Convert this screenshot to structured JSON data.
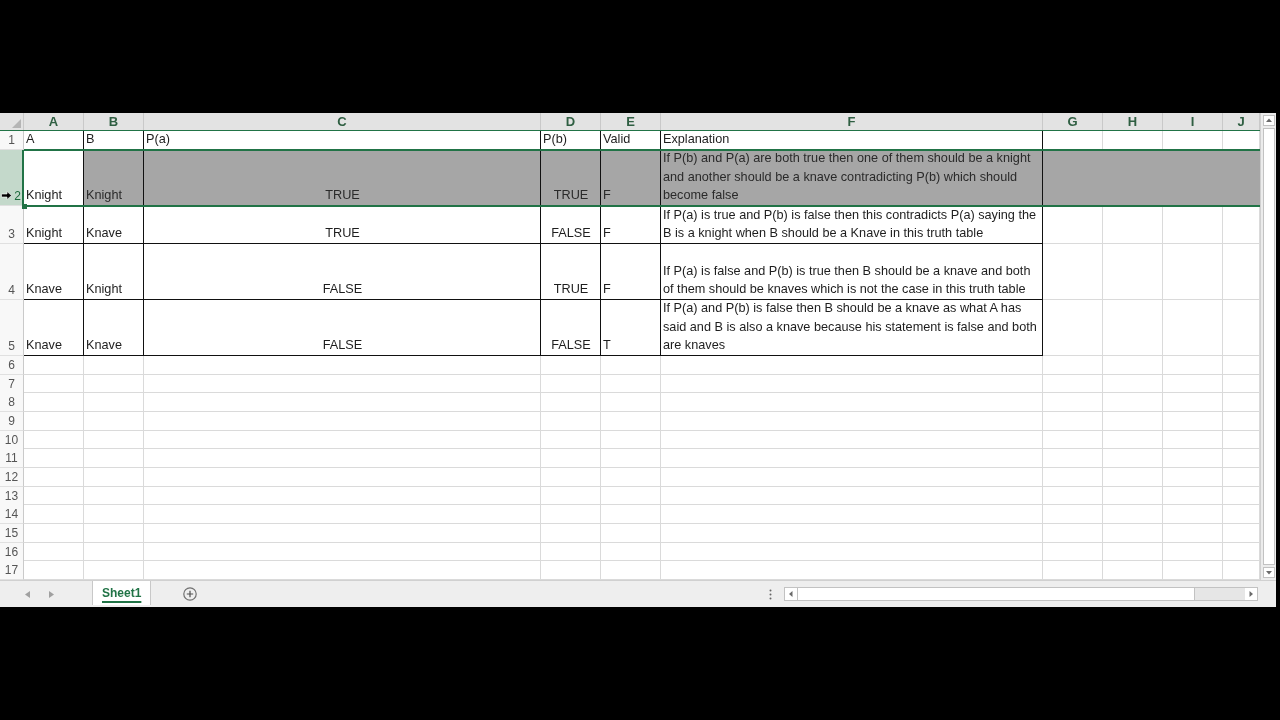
{
  "spreadsheet": {
    "columns": [
      "A",
      "B",
      "C",
      "D",
      "E",
      "F",
      "G",
      "H",
      "I",
      "J"
    ],
    "rows": [
      {
        "number": "1",
        "selected": false,
        "cells": [
          {
            "text": "A",
            "kind": "text"
          },
          {
            "text": "B",
            "kind": "text"
          },
          {
            "text": "P(a)",
            "kind": "text"
          },
          {
            "text": "P(b)",
            "kind": "text"
          },
          {
            "text": "Valid",
            "kind": "text"
          },
          {
            "text": "Explanation",
            "kind": "text"
          }
        ]
      },
      {
        "number": "2",
        "selected": true,
        "cells": [
          {
            "text": "Knight",
            "kind": "text"
          },
          {
            "text": "Knight",
            "kind": "text"
          },
          {
            "text": "TRUE",
            "kind": "boolean"
          },
          {
            "text": "TRUE",
            "kind": "boolean"
          },
          {
            "text": "F",
            "kind": "text"
          },
          {
            "text": "If P(b) and P(a) are both true then one of them should be a knight and another should be a knave contradicting P(b) which should become false",
            "kind": "text"
          }
        ]
      },
      {
        "number": "3",
        "selected": false,
        "cells": [
          {
            "text": "Knight",
            "kind": "text"
          },
          {
            "text": "Knave",
            "kind": "text"
          },
          {
            "text": "TRUE",
            "kind": "boolean"
          },
          {
            "text": "FALSE",
            "kind": "boolean"
          },
          {
            "text": "F",
            "kind": "text"
          },
          {
            "text": "If P(a) is true and P(b) is false then this contradicts P(a) saying the B is a knight when B should be a Knave in this truth table",
            "kind": "text"
          }
        ]
      },
      {
        "number": "4",
        "selected": false,
        "cells": [
          {
            "text": "Knave",
            "kind": "text"
          },
          {
            "text": "Knight",
            "kind": "text"
          },
          {
            "text": "FALSE",
            "kind": "boolean"
          },
          {
            "text": "TRUE",
            "kind": "boolean"
          },
          {
            "text": "F",
            "kind": "text"
          },
          {
            "text": "If P(a) is false and P(b) is true then B should be a knave and both of them should be knaves which is not the case in this truth table",
            "kind": "text"
          }
        ]
      },
      {
        "number": "5",
        "selected": false,
        "cells": [
          {
            "text": "Knave",
            "kind": "text"
          },
          {
            "text": "Knave",
            "kind": "text"
          },
          {
            "text": "FALSE",
            "kind": "boolean"
          },
          {
            "text": "FALSE",
            "kind": "boolean"
          },
          {
            "text": "T",
            "kind": "text"
          },
          {
            "text": "If P(a) and P(b) is false then B should be a knave as what A has said and B is also a knave because his statement is false and both are knaves",
            "kind": "text"
          }
        ]
      },
      {
        "number": "6",
        "selected": false
      },
      {
        "number": "7",
        "selected": false
      },
      {
        "number": "8",
        "selected": false
      },
      {
        "number": "9",
        "selected": false
      },
      {
        "number": "10",
        "selected": false
      },
      {
        "number": "11",
        "selected": false
      },
      {
        "number": "12",
        "selected": false
      },
      {
        "number": "13",
        "selected": false
      },
      {
        "number": "14",
        "selected": false
      },
      {
        "number": "15",
        "selected": false
      },
      {
        "number": "16",
        "selected": false
      },
      {
        "number": "17",
        "selected": false
      }
    ]
  },
  "sheet_tabs": [
    {
      "label": "Sheet1",
      "selected": true
    }
  ]
}
